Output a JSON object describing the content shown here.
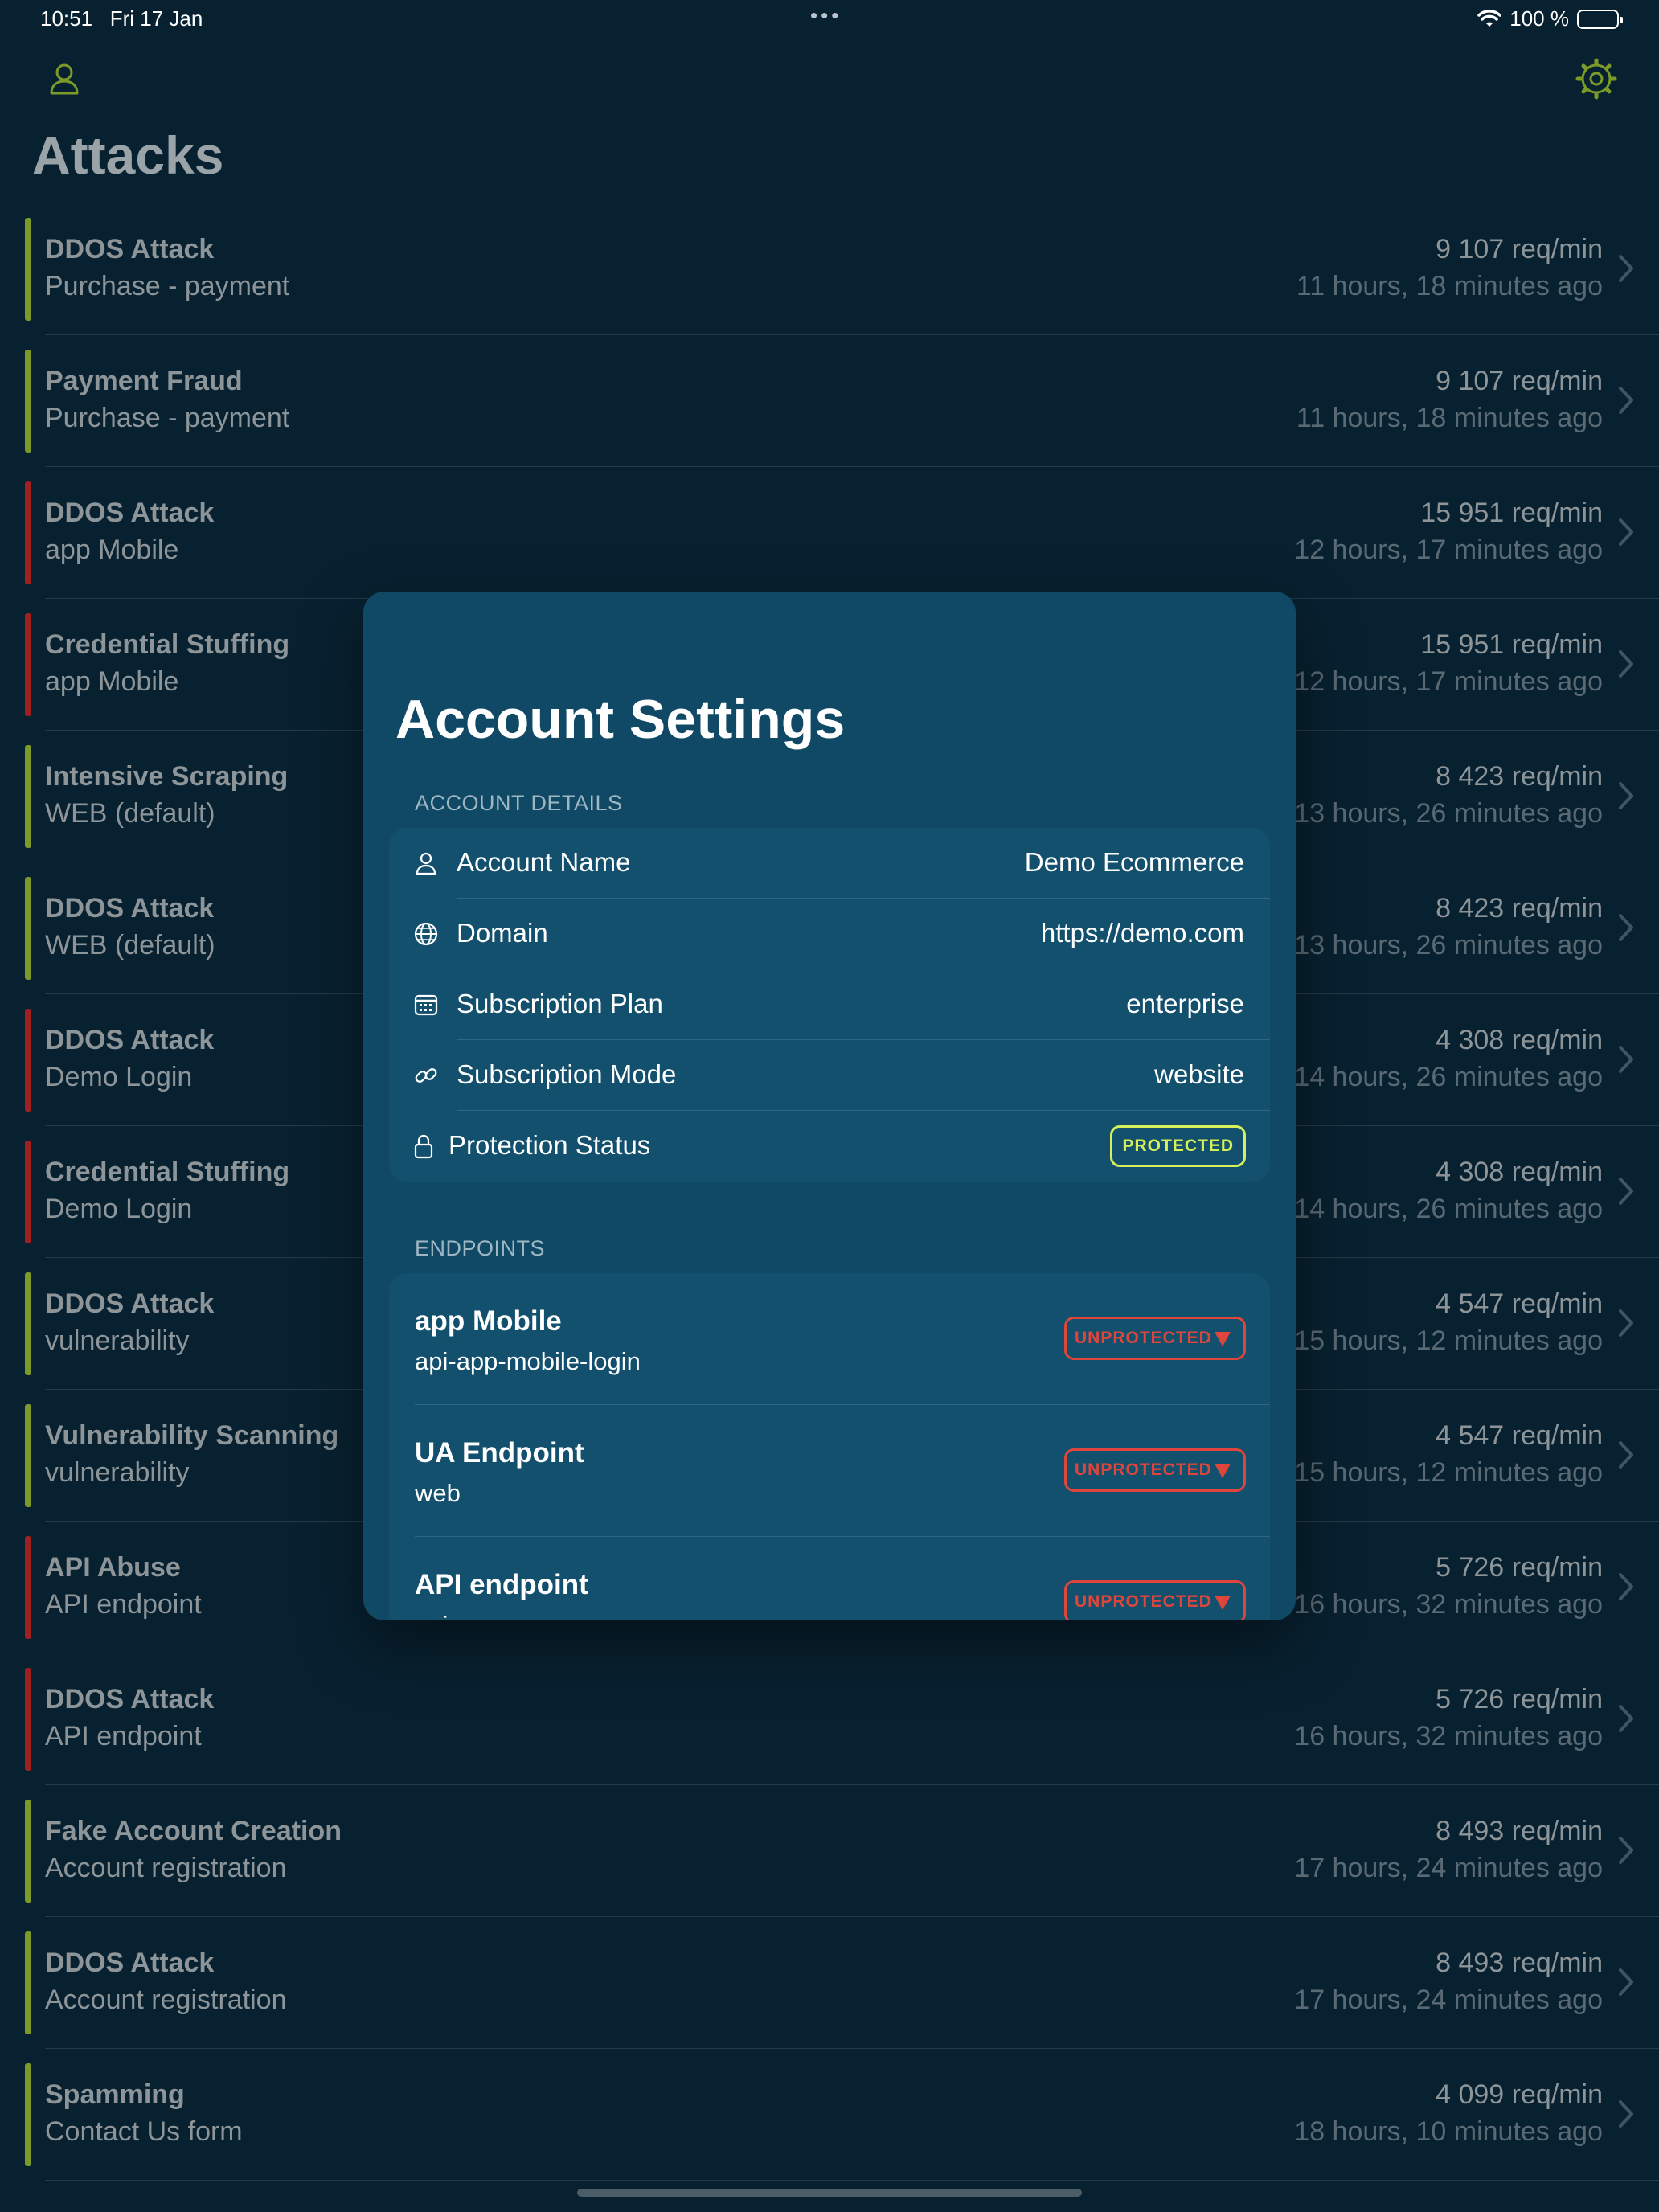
{
  "status_bar": {
    "time": "10:51",
    "date": "Fri 17 Jan",
    "battery": "100 %",
    "dots": "•••"
  },
  "nav": {
    "user_icon": "person-icon",
    "settings_icon": "gear-icon",
    "accent_color": "#7c9a2a"
  },
  "page_title": "Attacks",
  "attacks": [
    {
      "type": "DDOS Attack",
      "target": "Purchase - payment",
      "rate": "9 107 req/min",
      "time": "11 hours, 18 minutes ago",
      "severity": "green"
    },
    {
      "type": "Payment Fraud",
      "target": "Purchase - payment",
      "rate": "9 107 req/min",
      "time": "11 hours, 18 minutes ago",
      "severity": "green"
    },
    {
      "type": "DDOS Attack",
      "target": "app Mobile",
      "rate": "15 951 req/min",
      "time": "12 hours, 17 minutes ago",
      "severity": "red"
    },
    {
      "type": "Credential Stuffing",
      "target": "app Mobile",
      "rate": "15 951 req/min",
      "time": "12 hours, 17 minutes ago",
      "severity": "red"
    },
    {
      "type": "Intensive Scraping",
      "target": "WEB (default)",
      "rate": "8 423 req/min",
      "time": "13 hours, 26 minutes ago",
      "severity": "green"
    },
    {
      "type": "DDOS Attack",
      "target": "WEB (default)",
      "rate": "8 423 req/min",
      "time": "13 hours, 26 minutes ago",
      "severity": "green"
    },
    {
      "type": "DDOS Attack",
      "target": "Demo Login",
      "rate": "4 308 req/min",
      "time": "14 hours, 26 minutes ago",
      "severity": "red"
    },
    {
      "type": "Credential Stuffing",
      "target": "Demo Login",
      "rate": "4 308 req/min",
      "time": "14 hours, 26 minutes ago",
      "severity": "red"
    },
    {
      "type": "DDOS Attack",
      "target": "vulnerability",
      "rate": "4 547 req/min",
      "time": "15 hours, 12 minutes ago",
      "severity": "green"
    },
    {
      "type": "Vulnerability Scanning",
      "target": "vulnerability",
      "rate": "4 547 req/min",
      "time": "15 hours, 12 minutes ago",
      "severity": "green"
    },
    {
      "type": "API Abuse",
      "target": "API endpoint",
      "rate": "5 726 req/min",
      "time": "16 hours, 32 minutes ago",
      "severity": "red"
    },
    {
      "type": "DDOS Attack",
      "target": "API endpoint",
      "rate": "5 726 req/min",
      "time": "16 hours, 32 minutes ago",
      "severity": "red"
    },
    {
      "type": "Fake Account Creation",
      "target": "Account registration",
      "rate": "8 493 req/min",
      "time": "17 hours, 24 minutes ago",
      "severity": "green"
    },
    {
      "type": "DDOS Attack",
      "target": "Account registration",
      "rate": "8 493 req/min",
      "time": "17 hours, 24 minutes ago",
      "severity": "green"
    },
    {
      "type": "Spamming",
      "target": "Contact Us form",
      "rate": "4 099 req/min",
      "time": "18 hours, 10 minutes ago",
      "severity": "green"
    }
  ],
  "modal": {
    "title": "Account Settings",
    "account_section_label": "ACCOUNT DETAILS",
    "details": [
      {
        "icon": "person-icon",
        "label": "Account Name",
        "value": "Demo Ecommerce"
      },
      {
        "icon": "globe-icon",
        "label": "Domain",
        "value": "https://demo.com"
      },
      {
        "icon": "calendar-icon",
        "label": "Subscription Plan",
        "value": "enterprise"
      },
      {
        "icon": "link-icon",
        "label": "Subscription Mode",
        "value": "website"
      }
    ],
    "protection": {
      "icon": "lock-icon",
      "label": "Protection Status",
      "badge": "PROTECTED",
      "badge_color": "#d6f05a"
    },
    "endpoints_section_label": "ENDPOINTS",
    "endpoints": [
      {
        "name": "app Mobile",
        "sub": "api-app-mobile-login",
        "badge": "UNPROTECTED"
      },
      {
        "name": "UA Endpoint",
        "sub": "web",
        "badge": "UNPROTECTED"
      },
      {
        "name": "API endpoint",
        "sub": "api",
        "badge": "UNPROTECTED"
      }
    ],
    "unprotected_color": "#e0453c"
  }
}
